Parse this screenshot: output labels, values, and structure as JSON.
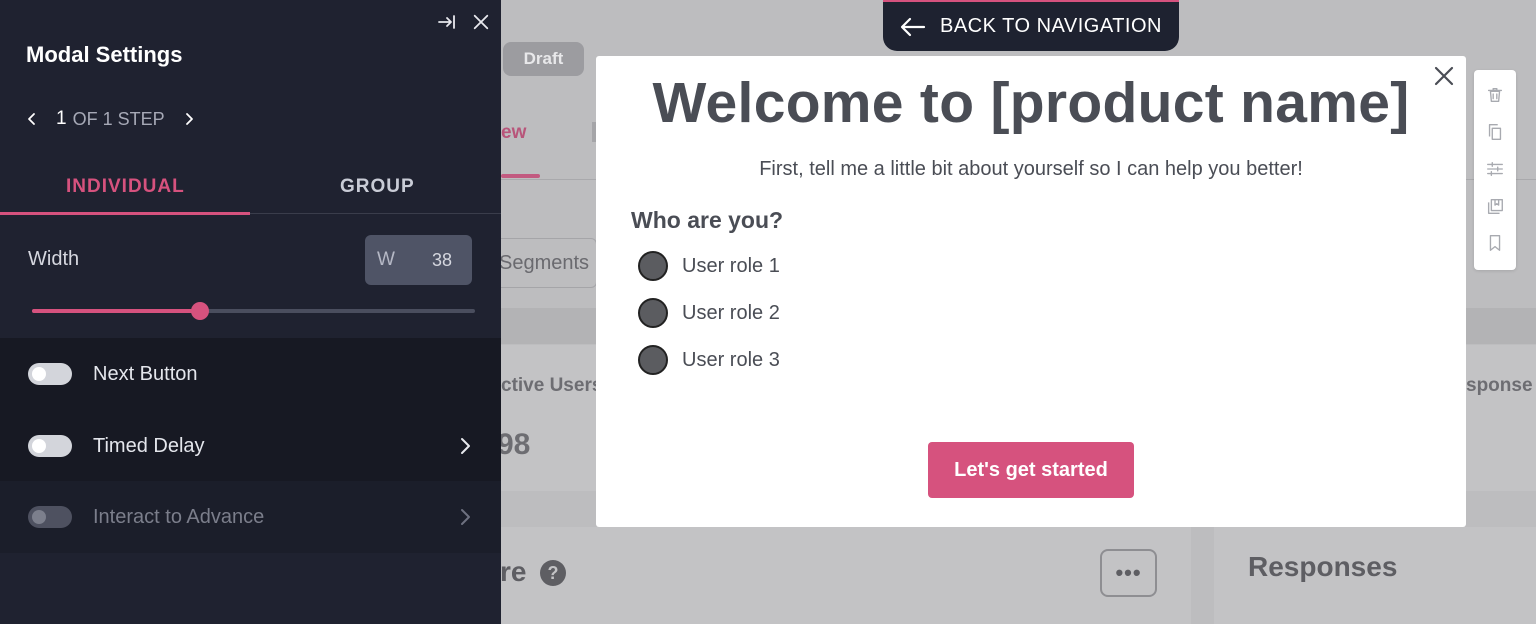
{
  "background": {
    "status_badge": "Draft",
    "tab_active": "ew",
    "segments_label": "Segments",
    "card1_label": "ctive Users",
    "card1_value": "98",
    "card2_label": "sponse R",
    "bottom_left_title": "re",
    "help_icon_text": "?",
    "more_label": "•••",
    "bottom_right_title": "Responses"
  },
  "back_nav": {
    "label": "BACK TO NAVIGATION",
    "icon": "arrow-left-icon"
  },
  "panel": {
    "title": "Modal Settings",
    "step": {
      "current": "1",
      "of_label": "OF 1 STEP"
    },
    "tabs": {
      "individual": "INDIVIDUAL",
      "group": "GROUP",
      "active": "individual"
    },
    "width": {
      "label": "Width",
      "prefix": "W",
      "value": "38",
      "slider_fraction": 0.38
    },
    "rows": {
      "next_button": {
        "label": "Next Button",
        "enabled": false
      },
      "timed_delay": {
        "label": "Timed Delay",
        "enabled": false
      },
      "interact_to_advance": {
        "label": "Interact to Advance",
        "enabled": false,
        "disabled": true
      }
    }
  },
  "modal": {
    "title": "Welcome to [product name]",
    "subtitle": "First, tell me a little bit about yourself so I can help you better!",
    "question": "Who are you?",
    "options": [
      "User role 1",
      "User role 2",
      "User role 3"
    ],
    "cta": "Let's get started"
  },
  "toolbar": {
    "icons": [
      "trash-icon",
      "copy-icon",
      "sliders-icon",
      "save-template-icon",
      "bookmark-icon"
    ]
  },
  "colors": {
    "accent": "#d6527e",
    "panel_bg": "#1f2230",
    "text_dark": "#4a4d55"
  }
}
